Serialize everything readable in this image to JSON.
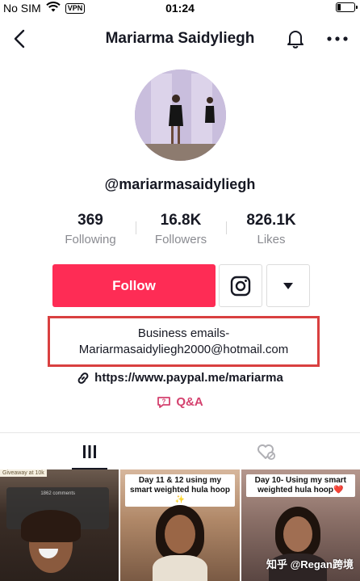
{
  "status_bar": {
    "carrier": "No SIM",
    "vpn_label": "VPN",
    "time": "01:24",
    "icons": [
      "wifi-icon",
      "battery-icon"
    ]
  },
  "header": {
    "title": "Mariarma Saidyliegh",
    "icons": [
      "back-arrow-icon",
      "bell-icon",
      "more-icon"
    ]
  },
  "profile": {
    "username": "@mariarmasaidyliegh",
    "stats": [
      {
        "value": "369",
        "label": "Following"
      },
      {
        "value": "16.8K",
        "label": "Followers"
      },
      {
        "value": "826.1K",
        "label": "Likes"
      }
    ]
  },
  "actions": {
    "follow_label": "Follow",
    "icons": [
      "instagram-icon",
      "caret-down-icon"
    ],
    "accent_color": "#fe2c55"
  },
  "bio": {
    "line1": "Business emails-",
    "line2": "Mariarmasaidyliegh2000@hotmail.com",
    "highlight_color": "#d94040"
  },
  "link": {
    "text": "https://www.paypal.me/mariarma",
    "icon": "link-icon"
  },
  "qa": {
    "label": "Q&A",
    "icon": "qa-icon",
    "color": "#d4416e"
  },
  "tabs": {
    "icons": [
      "videos-grid-icon",
      "liked-hidden-icon"
    ],
    "active": "videos"
  },
  "videos": [
    {
      "caption": "Giveaway at 10k",
      "overlay": "1862 comments"
    },
    {
      "caption": "Day 11 & 12 using my smart weighted hula hoop ✨"
    },
    {
      "caption": "Day 10- Using my smart weighted hula hoop❤️"
    }
  ],
  "watermark": "知乎 @Regan跨境"
}
